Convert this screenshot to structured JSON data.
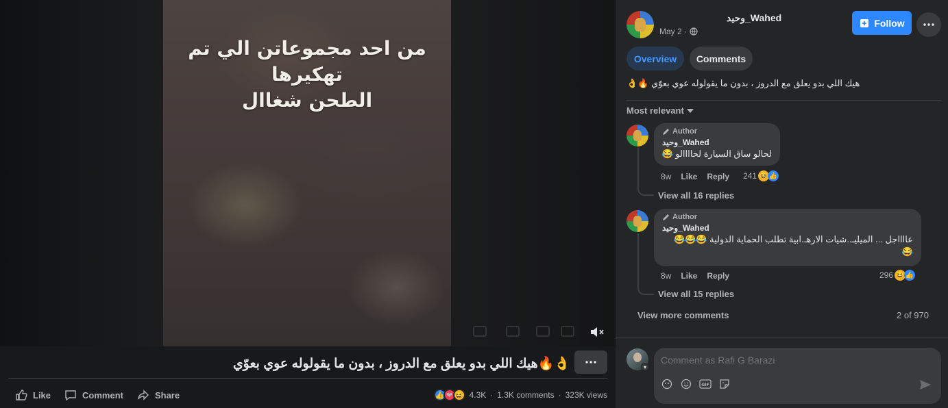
{
  "video": {
    "caption_lines": [
      "من احد مجموعاتن الي تم",
      "تهكيرها",
      "الطحن شغاال"
    ],
    "mute_icon": "speaker-muted-icon"
  },
  "post": {
    "title": "هيك اللي بدو يعلق مع الدروز ، بدون ما يقولوله عوي بعوّي",
    "title_emojis": "👌🔥",
    "actions": {
      "like": "Like",
      "comment": "Comment",
      "share": "Share"
    },
    "reactions_count": "4.3K",
    "comments_count": "1.3K comments",
    "views": "323K views"
  },
  "header": {
    "author_name": "وحيد_Wahed",
    "date": "May 2 ·",
    "follow_label": "Follow"
  },
  "tabs": {
    "overview": "Overview",
    "comments": "Comments"
  },
  "description": "هيك اللي بدو يعلق مع الدروز ، بدون ما يقولوله عوي بعوّي 🔥👌",
  "sort_label": "Most relevant",
  "comments": [
    {
      "author_tag": "Author",
      "name": "وحيد_Wahed",
      "text": "لحالو ساق السيارة لحاااالو 😂",
      "time": "8w",
      "like": "Like",
      "reply": "Reply",
      "count": "241",
      "view_replies": "View all 16 replies"
    },
    {
      "author_tag": "Author",
      "name": "وحيد_Wahed",
      "text_line1": "عااااجل ... الميليـ..شيات الارهـ.ابية تطلب الحماية الدولية 😂😂😂",
      "text_line2": "😂",
      "time": "8w",
      "like": "Like",
      "reply": "Reply",
      "count": "296",
      "view_replies": "View all 15 replies"
    }
  ],
  "view_more": "View more comments",
  "pager": "2 of 970",
  "composer": {
    "placeholder": "Comment as Rafi G Barazi"
  },
  "colors": {
    "accent": "#2d88ff",
    "bg": "#18191a",
    "panel": "#242526"
  }
}
